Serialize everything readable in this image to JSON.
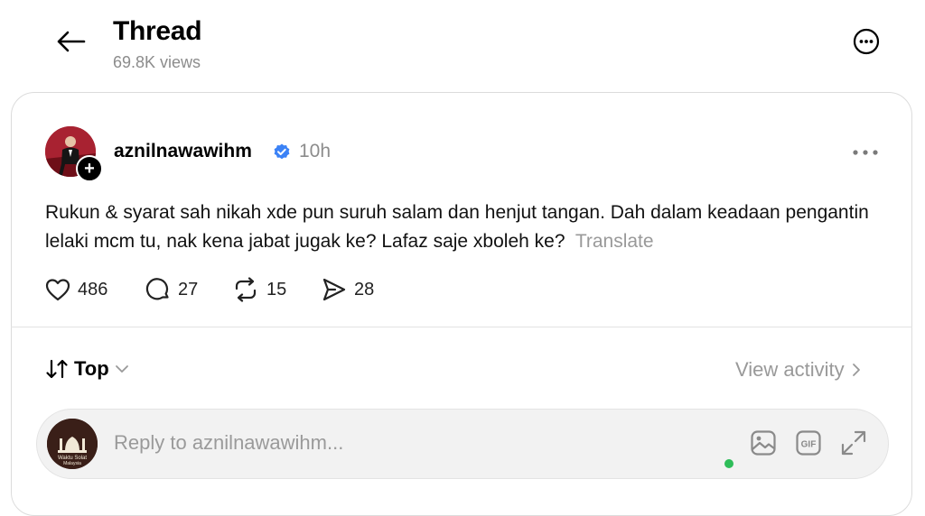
{
  "header": {
    "title": "Thread",
    "views": "69.8K views",
    "back_icon": "back-arrow-icon",
    "more_icon": "more-circle-icon"
  },
  "post": {
    "username": "aznilnawawihm",
    "verified": true,
    "time": "10h",
    "text": "Rukun & syarat sah nikah xde pun suruh salam dan henjut tangan. Dah dalam keadaan pengantin lelaki mcm tu, nak kena jabat jugak ke? Lafaz saje xboleh ke?",
    "translate": "Translate",
    "follow_badge": "+",
    "actions": {
      "likes": "486",
      "replies": "27",
      "reposts": "15",
      "shares": "28"
    }
  },
  "sort": {
    "label": "Top"
  },
  "activity": {
    "label": "View activity"
  },
  "reply": {
    "placeholder": "Reply to aznilnawawihm...",
    "gif_label": "GIF",
    "avatar_text_1": "Waktu Solat",
    "avatar_text_2": "Malaysia"
  },
  "colors": {
    "verified": "#3b82f6",
    "muted": "#8c8c8c",
    "online": "#2ebd59"
  }
}
